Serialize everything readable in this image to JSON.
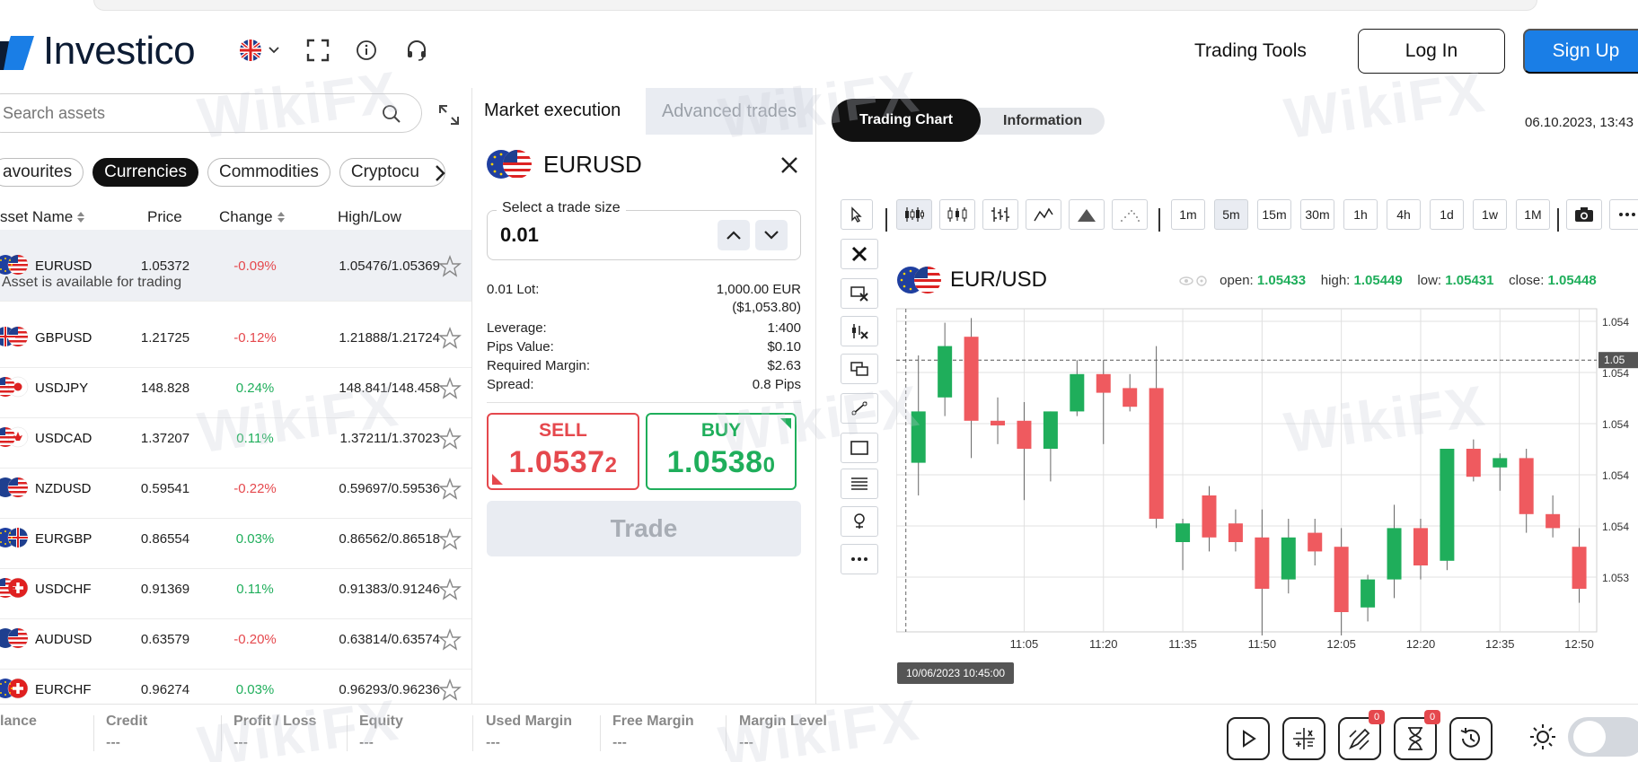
{
  "header": {
    "logo_text": "Investico",
    "trading_tools": "Trading Tools",
    "login": "Log In",
    "signup": "Sign Up"
  },
  "assets_panel": {
    "search_placeholder": "Search assets",
    "categories": [
      "avourites",
      "Currencies",
      "Commodities",
      "Cryptocu"
    ],
    "active_category": "Currencies",
    "columns": {
      "name": "sset Name",
      "price": "Price",
      "change": "Change",
      "highlow": "High/Low"
    },
    "available_note": "Asset is available for trading",
    "rows": [
      {
        "name": "EURUSD",
        "price": "1.05372",
        "change": "-0.09%",
        "highlow": "1.05476/1.05369",
        "dir": "neg",
        "flag": "eu-us"
      },
      {
        "name": "GBPUSD",
        "price": "1.21725",
        "change": "-0.12%",
        "highlow": "1.21888/1.21724",
        "dir": "neg",
        "flag": "uk-us"
      },
      {
        "name": "USDJPY",
        "price": "148.828",
        "change": "0.24%",
        "highlow": "148.841/148.458",
        "dir": "pos",
        "flag": "us-jp"
      },
      {
        "name": "USDCAD",
        "price": "1.37207",
        "change": "0.11%",
        "highlow": "1.37211/1.37023",
        "dir": "pos",
        "flag": "us-ca"
      },
      {
        "name": "NZDUSD",
        "price": "0.59541",
        "change": "-0.22%",
        "highlow": "0.59697/0.59536",
        "dir": "neg",
        "flag": "nz-us"
      },
      {
        "name": "EURGBP",
        "price": "0.86554",
        "change": "0.03%",
        "highlow": "0.86562/0.86518",
        "dir": "pos",
        "flag": "eu-uk"
      },
      {
        "name": "USDCHF",
        "price": "0.91369",
        "change": "0.11%",
        "highlow": "0.91383/0.91246",
        "dir": "pos",
        "flag": "us-ch"
      },
      {
        "name": "AUDUSD",
        "price": "0.63579",
        "change": "-0.20%",
        "highlow": "0.63814/0.63574",
        "dir": "neg",
        "flag": "au-us"
      },
      {
        "name": "EURCHF",
        "price": "0.96274",
        "change": "0.03%",
        "highlow": "0.96293/0.96236",
        "dir": "pos",
        "flag": "eu-ch"
      }
    ]
  },
  "trade_panel": {
    "tab_market": "Market execution",
    "tab_advanced": "Advanced trades",
    "symbol": "EURUSD",
    "size_label": "Select a trade size",
    "size_value": "0.01",
    "lot_label": "0.01 Lot:",
    "lot_value": "1,000.00 EUR",
    "lot_value_usd": "($1,053.80)",
    "leverage_label": "Leverage:",
    "leverage_value": "1:400",
    "pips_label": "Pips Value:",
    "pips_value": "$0.10",
    "margin_label": "Required Margin:",
    "margin_value": "$2.63",
    "spread_label": "Spread:",
    "spread_value": "0.8 Pips",
    "sell_label": "SELL",
    "sell_price_main": "1.0537",
    "sell_price_last": "2",
    "buy_label": "BUY",
    "buy_price_main": "1.0538",
    "buy_price_last": "0",
    "trade_button": "Trade"
  },
  "chart_panel": {
    "tab_chart": "Trading Chart",
    "tab_info": "Information",
    "datetime": "06.10.2023, 13:43",
    "timeframes": [
      "1m",
      "5m",
      "15m",
      "30m",
      "1h",
      "4h",
      "1d",
      "1w",
      "1M"
    ],
    "active_timeframe": "5m",
    "symbol": "EUR/USD",
    "ohlc": {
      "open_label": "open:",
      "open": "1.05433",
      "high_label": "high:",
      "high": "1.05449",
      "low_label": "low:",
      "low": "1.05431",
      "close_label": "close:",
      "close": "1.05448"
    },
    "x_ticks": [
      "11:05",
      "11:20",
      "11:35",
      "11:50",
      "12:05",
      "12:20",
      "12:35",
      "12:50"
    ],
    "y_ticks": [
      "1.054",
      "1.054",
      "1.054",
      "1.054",
      "1.054",
      "1.053"
    ],
    "price_line_label": "1.05",
    "crosshair_date": "10/06/2023 10:45:00",
    "colors": {
      "up": "#1fae5b",
      "down": "#ef5a5f"
    }
  },
  "chart_data": {
    "type": "candlestick",
    "title": "EUR/USD",
    "x": [
      "10:45",
      "10:50",
      "10:55",
      "11:00",
      "11:05",
      "11:10",
      "11:15",
      "11:20",
      "11:25",
      "11:30",
      "11:35",
      "11:40",
      "11:45",
      "11:50",
      "11:55",
      "12:00",
      "12:05",
      "12:10",
      "12:15",
      "12:20",
      "12:25",
      "12:30",
      "12:35",
      "12:40",
      "12:45",
      "12:50"
    ],
    "candles": [
      {
        "o": 1.05422,
        "h": 1.05445,
        "l": 1.05415,
        "c": 1.05433
      },
      {
        "o": 1.05436,
        "h": 1.05452,
        "l": 1.05432,
        "c": 1.05447
      },
      {
        "o": 1.05449,
        "h": 1.05453,
        "l": 1.05423,
        "c": 1.05431
      },
      {
        "o": 1.05431,
        "h": 1.05436,
        "l": 1.05426,
        "c": 1.0543
      },
      {
        "o": 1.05431,
        "h": 1.05435,
        "l": 1.05414,
        "c": 1.05425
      },
      {
        "o": 1.05425,
        "h": 1.05433,
        "l": 1.05418,
        "c": 1.05433
      },
      {
        "o": 1.05433,
        "h": 1.05444,
        "l": 1.05432,
        "c": 1.05441
      },
      {
        "o": 1.05441,
        "h": 1.05444,
        "l": 1.05426,
        "c": 1.05437
      },
      {
        "o": 1.05438,
        "h": 1.05441,
        "l": 1.05433,
        "c": 1.05434
      },
      {
        "o": 1.05438,
        "h": 1.05447,
        "l": 1.05408,
        "c": 1.0541
      },
      {
        "o": 1.05405,
        "h": 1.0541,
        "l": 1.05399,
        "c": 1.05409
      },
      {
        "o": 1.05415,
        "h": 1.05417,
        "l": 1.05403,
        "c": 1.05406
      },
      {
        "o": 1.05409,
        "h": 1.05412,
        "l": 1.05403,
        "c": 1.05405
      },
      {
        "o": 1.05406,
        "h": 1.05412,
        "l": 1.05385,
        "c": 1.05395
      },
      {
        "o": 1.05397,
        "h": 1.0541,
        "l": 1.05394,
        "c": 1.05406
      },
      {
        "o": 1.05407,
        "h": 1.0541,
        "l": 1.054,
        "c": 1.05403
      },
      {
        "o": 1.05404,
        "h": 1.05408,
        "l": 1.05385,
        "c": 1.0539
      },
      {
        "o": 1.05391,
        "h": 1.05398,
        "l": 1.05388,
        "c": 1.05397
      },
      {
        "o": 1.05397,
        "h": 1.05413,
        "l": 1.05393,
        "c": 1.05408
      },
      {
        "o": 1.05408,
        "h": 1.0541,
        "l": 1.05397,
        "c": 1.054
      },
      {
        "o": 1.05401,
        "h": 1.05425,
        "l": 1.05399,
        "c": 1.05425
      },
      {
        "o": 1.05425,
        "h": 1.05427,
        "l": 1.05418,
        "c": 1.05419
      },
      {
        "o": 1.05421,
        "h": 1.05424,
        "l": 1.05416,
        "c": 1.05423
      },
      {
        "o": 1.05423,
        "h": 1.05425,
        "l": 1.05407,
        "c": 1.05411
      },
      {
        "o": 1.05411,
        "h": 1.05415,
        "l": 1.05406,
        "c": 1.05408
      },
      {
        "o": 1.05404,
        "h": 1.05408,
        "l": 1.05392,
        "c": 1.05395
      }
    ],
    "ylim": [
      1.0538,
      1.05455
    ],
    "xlabel": "",
    "ylabel": ""
  },
  "footer": {
    "labels": [
      "lance",
      "Credit",
      "Profit / Loss",
      "Equity",
      "Used Margin",
      "Free Margin",
      "Margin Level"
    ],
    "values": [
      "",
      "---",
      "---",
      "---",
      "---",
      "---",
      "---"
    ],
    "badge_a": "0",
    "badge_b": "0"
  },
  "watermark": "WikiFX"
}
